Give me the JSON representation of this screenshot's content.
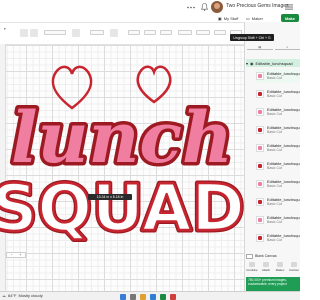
{
  "header": {
    "project_name": "Two Precious Gems Images",
    "nav": {
      "my_stuff": "My Stuff",
      "maker": "Maker",
      "make": "Make"
    }
  },
  "tooltip": {
    "text": "Ungroup Shift + Ctrl + G"
  },
  "canvas": {
    "design_text": {
      "line1": "lunch",
      "line2": "SQUAD"
    },
    "size_tag": "13.34 in x 8.18 in"
  },
  "layers": {
    "group_name": "Editable_lunchsquad",
    "items": [
      {
        "name": "Editable_lunchsquad",
        "sub": "Basic Cut"
      },
      {
        "name": "Editable_lunchsquad",
        "sub": "Basic Cut"
      },
      {
        "name": "Editable_lunchsquad",
        "sub": "Basic Cut"
      },
      {
        "name": "Editable_lunchsquad",
        "sub": "Basic Cut"
      },
      {
        "name": "Editable_lunchsquad",
        "sub": "Basic Cut"
      },
      {
        "name": "Editable_lunchsquad",
        "sub": "Basic Cut"
      },
      {
        "name": "Editable_lunchsquad",
        "sub": "Basic Cut"
      },
      {
        "name": "Editable_lunchsquad",
        "sub": "Basic Cut"
      },
      {
        "name": "Editable_lunchsquad",
        "sub": "Basic Cut"
      },
      {
        "name": "Editable_lunchsquad",
        "sub": "Basic Cut"
      }
    ],
    "blank_canvas": "Blank Canvas",
    "actions": [
      "Combine",
      "Attach",
      "Flatten",
      "Contour"
    ],
    "notice": "750,000+ premium images, customizable, every project"
  },
  "taskbar": {
    "weather_temp": "64°F",
    "weather_desc": "Mostly cloudy"
  },
  "colors": {
    "pink": "#f07ea0",
    "red": "#c7252f",
    "dark_red": "#9e1a22",
    "green": "#1a8a3f",
    "selected_bg": "#d3efe0"
  }
}
